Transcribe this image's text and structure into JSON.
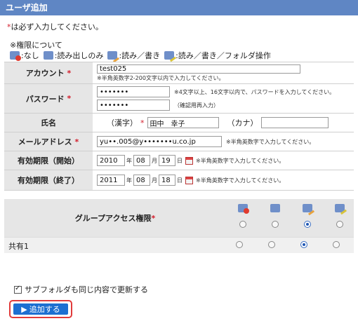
{
  "window": {
    "title": "ユーザ追加"
  },
  "required_note": {
    "star": "*",
    "text": "は必ず入力してください。"
  },
  "permissions": {
    "heading": "※権限について",
    "legend": [
      {
        "icon": "none-icon",
        "label": ":なし"
      },
      {
        "icon": "read-only-icon",
        "label": ":読み出しのみ"
      },
      {
        "icon": "read-write-icon",
        "label": ":読み／書き"
      },
      {
        "icon": "read-write-folder-icon",
        "label": ":読み／書き／フォルダ操作"
      }
    ]
  },
  "form": {
    "account": {
      "label": "アカウント",
      "value": "test025",
      "hint": "※半角英数字2-200文字以内で入力してください。"
    },
    "password": {
      "label": "パスワード",
      "value": "•••••••",
      "confirm_value": "•••••••",
      "hint": "※4文字以上、16文字以内で、パスワードを入力してください。",
      "confirm_hint": "（確認用再入力）"
    },
    "name": {
      "label": "氏名",
      "kanji_label": "（漢字）",
      "kanji_value": "田中　幸子",
      "kana_label": "（カナ）",
      "kana_value": ""
    },
    "email": {
      "label": "メールアドレス",
      "value": "yu••.005@y•••••••u.co.jp",
      "hint": "※半角英数字で入力してください。"
    },
    "start": {
      "label": "有効期限（開始）",
      "year": "2010",
      "year_unit": "年",
      "month": "08",
      "month_unit": "月",
      "day": "19",
      "day_unit": "日",
      "hint": "※半角英数字で入力してください。"
    },
    "end": {
      "label": "有効期限（終了）",
      "year": "2011",
      "year_unit": "年",
      "month": "08",
      "month_unit": "月",
      "day": "18",
      "day_unit": "日",
      "hint": "※半角英数字で入力してください。"
    }
  },
  "group_access": {
    "title": "グループアクセス権限",
    "star": "*",
    "columns": [
      "none-icon",
      "read-only-icon",
      "read-write-icon",
      "read-write-folder-icon"
    ],
    "default_selected": 2,
    "shares": [
      {
        "name": "共有1",
        "selected": 2
      }
    ]
  },
  "subfolder": {
    "label": "サブフォルダも同じ内容で更新する",
    "checked": true
  },
  "add_button": {
    "label": "追加する"
  },
  "colors": {
    "titlebar": "#5f86c4",
    "required": "#d31d2b",
    "button": "#1d6fd1",
    "highlight": "#e13b3b"
  }
}
